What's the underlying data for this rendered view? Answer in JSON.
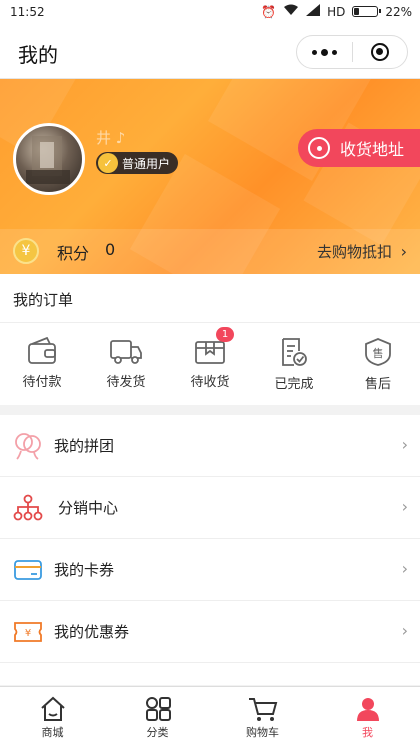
{
  "status_bar": {
    "time": "11:52",
    "network": "HD",
    "battery": "22%",
    "battery_level": 0.22
  },
  "nav": {
    "title": "我的"
  },
  "profile": {
    "username": "井 ♪",
    "member_level": "普通用户",
    "address_button": "收货地址",
    "points_label": "积分",
    "points_value": "0",
    "redeem_label": "去购物抵扣",
    "chevron": "›"
  },
  "orders": {
    "title": "我的订单",
    "items": [
      {
        "label": "待付款",
        "icon": "wallet-icon"
      },
      {
        "label": "待发货",
        "icon": "truck-icon"
      },
      {
        "label": "待收货",
        "icon": "package-icon",
        "badge": "1"
      },
      {
        "label": "已完成",
        "icon": "completed-doc-icon"
      },
      {
        "label": "售后",
        "icon": "after-sale-icon"
      }
    ]
  },
  "menu": [
    {
      "label": "我的拼团",
      "icon": "group-buy-icon"
    },
    {
      "label": "分销中心",
      "icon": "distribution-icon"
    },
    {
      "label": "我的卡券",
      "icon": "card-icon"
    },
    {
      "label": "我的优惠券",
      "icon": "coupon-icon"
    },
    {
      "label": "",
      "icon": "partial-menu-icon"
    }
  ],
  "tabbar": [
    {
      "label": "商城",
      "icon": "home-icon"
    },
    {
      "label": "分类",
      "icon": "category-icon"
    },
    {
      "label": "购物车",
      "icon": "cart-icon"
    },
    {
      "label": "我",
      "icon": "user-icon",
      "active": true
    }
  ],
  "colors": {
    "accent": "#f2475c",
    "header_orange": "#ffa236",
    "coin": "#f5c542"
  }
}
